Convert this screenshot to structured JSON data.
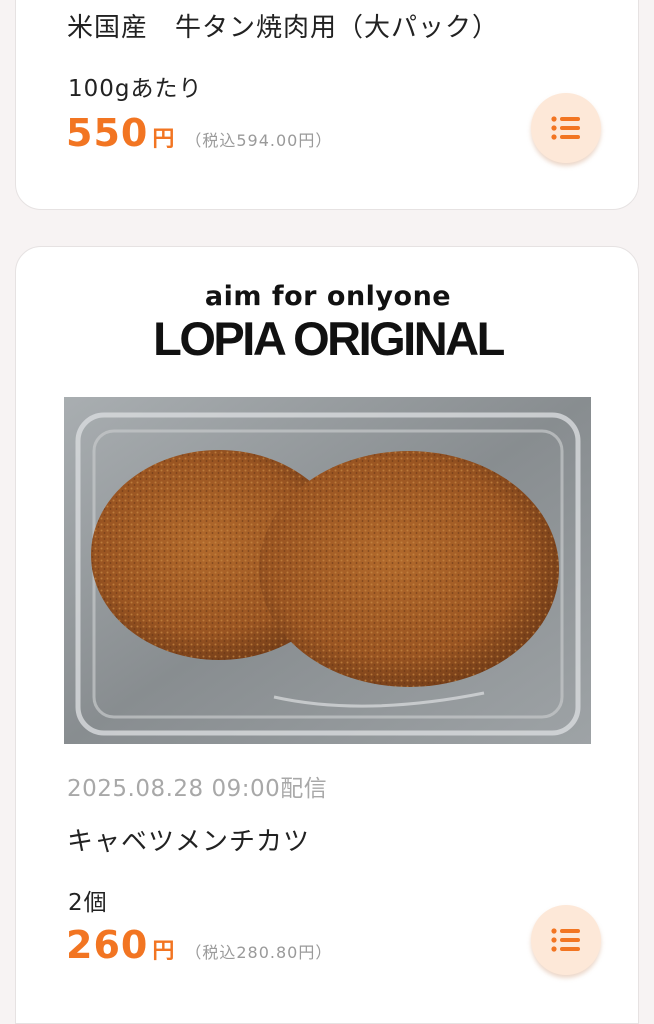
{
  "items": [
    {
      "title": "米国産　牛タン焼肉用（大パック）",
      "unit": "100gあたり",
      "price": "550",
      "yen": "円",
      "tax": "（税込594.00円）"
    },
    {
      "brand_tagline": "aim for onlyone",
      "brand_name": "LOPIA ORIGINAL",
      "date": "2025.08.28 09:00配信",
      "title": "キャベツメンチカツ",
      "unit": "2個",
      "price": "260",
      "yen": "円",
      "tax": "（税込280.80円）",
      "image": "menchi-katsu-photo"
    }
  ],
  "icons": {
    "list_button": "list-icon"
  },
  "colors": {
    "accent": "#f27522",
    "button_bg": "#fde8d8",
    "tax_text": "#9a9a9a"
  }
}
